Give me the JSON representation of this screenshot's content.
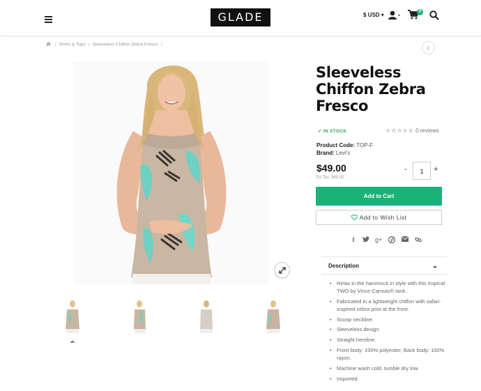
{
  "header": {
    "logo": "GLADE",
    "currency_label": "$ USD",
    "cart_count": "0",
    "icons": [
      "menu-icon",
      "user-icon",
      "cart-icon",
      "search-icon"
    ]
  },
  "breadcrumb": {
    "items": [
      "Shirts & Tops",
      "Sleeveless Chiffon Zebra Fresco"
    ],
    "home_icon": "home-icon"
  },
  "product": {
    "title": "Sleeveless Chiffon Zebra Fresco",
    "stock": "IN STOCK",
    "rating_stars": "☆☆☆☆☆",
    "reviews": "0 reviews",
    "product_code_label": "Product Code:",
    "product_code": "TOP-F",
    "brand_label": "Brand:",
    "brand": "Levi's",
    "price": "$49.00",
    "ex_tax": "Ex Tax: $49.00",
    "quantity": "1",
    "qty_minus": "-",
    "qty_plus": "+",
    "add_to_cart": "Add to Cart",
    "add_to_wishlist": "Add to Wish List"
  },
  "share_icons": [
    "facebook-icon",
    "twitter-icon",
    "google-plus-icon",
    "pinterest-icon",
    "email-icon",
    "link-icon"
  ],
  "description": {
    "heading": "Description",
    "items": [
      "Relax in the hammock in style with this tropical TWO by Vince Camuto® tank.",
      "Fabricated in a lightweight chiffon with safari-inspired zebra print at the front.",
      "Scoop neckline.",
      "Sleeveless design.",
      "Straight hemline.",
      "Front body: 100% polyester; Back body: 100% rayon.",
      "Machine wash cold, tumble dry low.",
      "Imported."
    ]
  },
  "colors": {
    "accent": "#1ab379",
    "stock": "#2ea44f",
    "logo_bg": "#111111"
  }
}
